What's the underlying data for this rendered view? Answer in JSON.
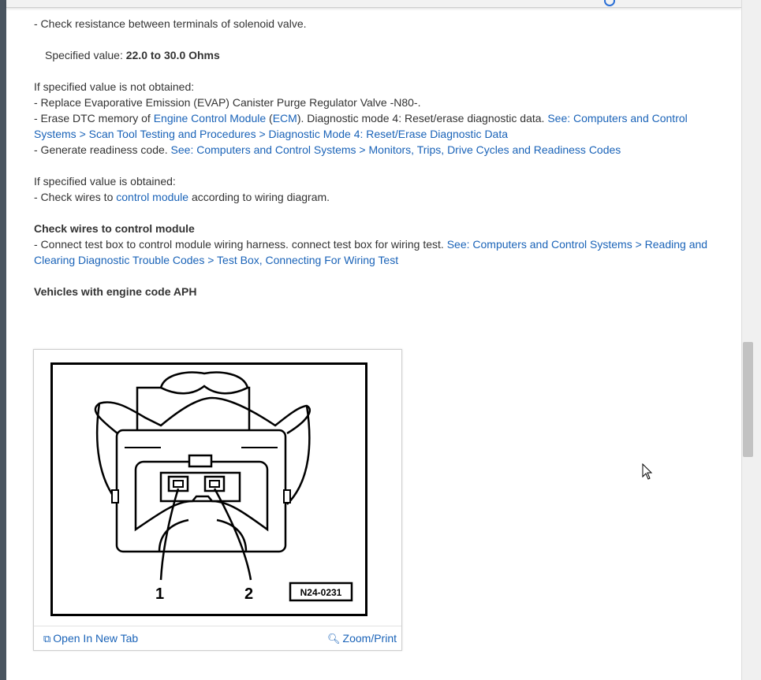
{
  "content": {
    "l1": "-  Check resistance between terminals of solenoid valve.",
    "spec_label": "Specified value: ",
    "spec_value": "22.0 to 30.0 Ohms",
    "not_obtained": "If specified value is not obtained:",
    "replace": "-  Replace Evaporative Emission (EVAP) Canister Purge Regulator Valve -N80-.",
    "erase_a": "-  Erase DTC memory of ",
    "ecm_link": "Engine Control Module",
    "paren_open": " (",
    "ecm_abbr": "ECM",
    "erase_b": "). Diagnostic mode 4: Reset/erase diagnostic data. ",
    "erase_link": "See: Computers and Control Systems > Scan Tool Testing and Procedures > Diagnostic Mode 4: Reset/Erase Diagnostic Data",
    "generate": "-  Generate readiness code. ",
    "generate_link": "See: Computers and Control Systems > Monitors, Trips, Drive Cycles and Readiness Codes",
    "obtained": "If specified value is obtained:",
    "check_a": "-  Check wires to ",
    "check_link": "control module",
    "check_b": " according to wiring diagram.",
    "heading_wires": "Check wires to control module",
    "connect": "-  Connect test box to control module wiring harness. connect test box for wiring test. ",
    "connect_link": "See: Computers and Control Systems > Reading and Clearing Diagnostic Trouble Codes > Test Box, Connecting For Wiring Test",
    "heading_vehicles": "Vehicles with engine code APH"
  },
  "figure": {
    "pin1": "1",
    "pin2": "2",
    "code": "N24-0231",
    "open_tab": "Open In New Tab",
    "zoom": "Zoom/Print"
  },
  "icons": {
    "open_tab_icon": "open-in-new-tab-icon",
    "zoom_icon": "magnifier-plus-icon"
  },
  "colors": {
    "link": "#1a63b8",
    "text": "#333333"
  }
}
